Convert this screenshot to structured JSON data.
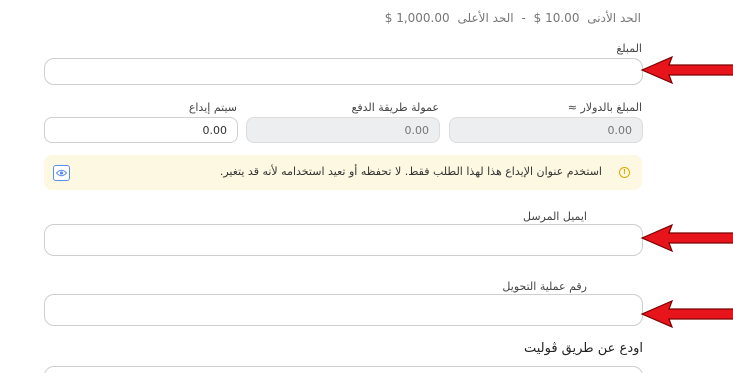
{
  "limits": {
    "min_label": "الحد الأدنى",
    "min_value": "10.00 $",
    "separator": "-",
    "max_label": "الحد الأعلى",
    "max_value": "1,000.00 $"
  },
  "amount": {
    "label": "المبلغ",
    "value": ""
  },
  "usd_amount": {
    "label": "المبلغ بالدولار ≈",
    "placeholder": "0.00"
  },
  "fee": {
    "label": "عمولة طريقة الدفع",
    "placeholder": "0.00"
  },
  "deposit_system": {
    "label": "سيتم إيداع",
    "value": "0.00"
  },
  "notice": {
    "text": "استخدم عنوان الإيداع هذا لهذا الطلب فقط. لا تحفظه أو تعيد استخدامه لأنه قد يتغير."
  },
  "sender_email": {
    "label": "ايميل المرسل",
    "value": ""
  },
  "transfer_id": {
    "label": "رقم عملية التحويل",
    "value": ""
  },
  "section": {
    "title": "اودع عن طريق ڤوليت"
  },
  "colors": {
    "arrow": "#e8141c",
    "notice_bg": "#fdf8e1",
    "warn": "#e0a800",
    "eye": "#5b8def"
  },
  "icons": [
    "warning-icon",
    "eye-icon",
    "red-arrow-annotation"
  ]
}
